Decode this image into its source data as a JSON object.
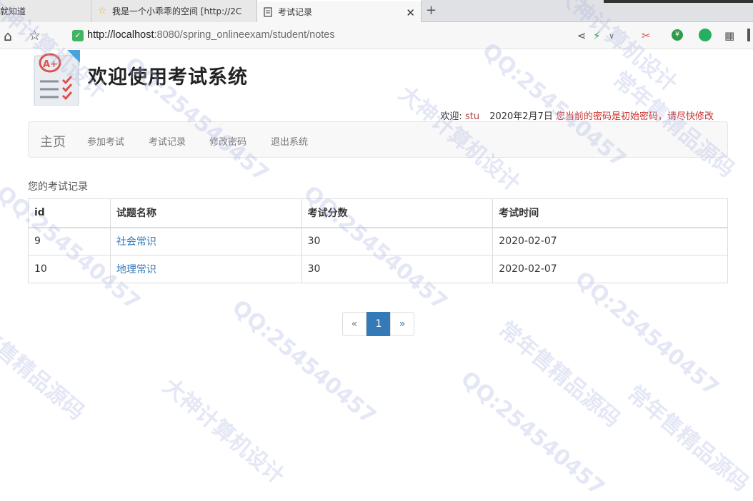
{
  "browser": {
    "tabs": [
      {
        "title": "就知道",
        "icon": "blank-page-icon"
      },
      {
        "title": "我是一个小乖乖的空间 [http://2C",
        "icon": "star-icon"
      },
      {
        "title": "考试记录",
        "icon": "page-icon"
      }
    ],
    "new_tab": "+",
    "close": "✕",
    "url_host": "http://localhost",
    "url_rest": ":8080/spring_onlineexam/student/notes"
  },
  "header": {
    "title": "欢迎使用考试系统",
    "welcome_label": "欢迎:",
    "username": "stu",
    "date": "2020年2月7日",
    "warning": "您当前的密码是初始密码，请尽快修改"
  },
  "nav": {
    "brand": "主页",
    "items": [
      "参加考试",
      "考试记录",
      "修改密码",
      "退出系统"
    ]
  },
  "records": {
    "title": "您的考试记录",
    "columns": [
      "id",
      "试题名称",
      "考试分数",
      "考试时间"
    ],
    "rows": [
      {
        "id": "9",
        "name": "社会常识",
        "score": "30",
        "time": "2020-02-07"
      },
      {
        "id": "10",
        "name": "地理常识",
        "score": "30",
        "time": "2020-02-07"
      }
    ]
  },
  "pagination": {
    "prev": "«",
    "current": "1",
    "next": "»"
  },
  "watermarks": [
    "大神计算机设计",
    "QQ:254540457",
    "常年售精品源码"
  ]
}
